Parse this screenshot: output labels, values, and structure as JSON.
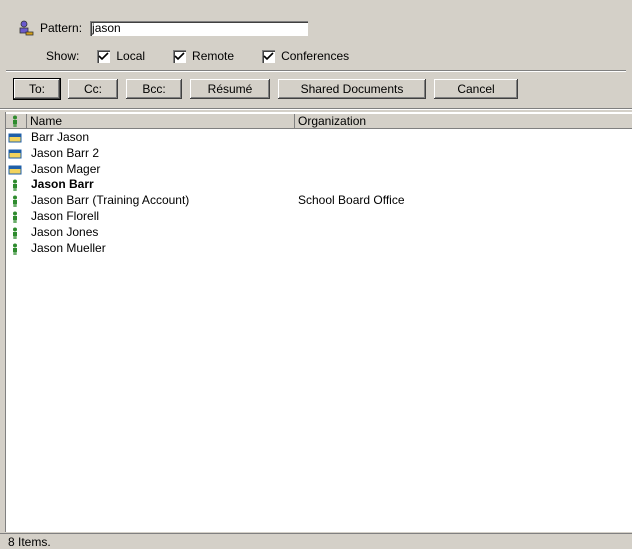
{
  "search": {
    "pattern_label": "Pattern:",
    "pattern_value": "jason",
    "show_label": "Show:",
    "filters": [
      {
        "label": "Local",
        "checked": true
      },
      {
        "label": "Remote",
        "checked": true
      },
      {
        "label": "Conferences",
        "checked": true
      }
    ]
  },
  "buttons": {
    "to": "To:",
    "cc": "Cc:",
    "bcc": "Bcc:",
    "resume": "Résumé",
    "shared_documents": "Shared Documents",
    "cancel": "Cancel"
  },
  "list": {
    "columns": {
      "name": "Name",
      "organization": "Organization"
    },
    "rows": [
      {
        "icon": "group-card-icon",
        "name": "Barr Jason",
        "organization": "",
        "bold": false
      },
      {
        "icon": "group-card-icon",
        "name": "Jason Barr 2",
        "organization": "",
        "bold": false
      },
      {
        "icon": "group-card-icon",
        "name": "Jason Mager",
        "organization": "",
        "bold": false
      },
      {
        "icon": "person-icon",
        "name": "Jason Barr",
        "organization": "",
        "bold": true
      },
      {
        "icon": "person-icon",
        "name": "Jason Barr (Training Account)",
        "organization": "School Board Office",
        "bold": false
      },
      {
        "icon": "person-icon",
        "name": "Jason Florell",
        "organization": "",
        "bold": false
      },
      {
        "icon": "person-icon",
        "name": "Jason Jones",
        "organization": "",
        "bold": false
      },
      {
        "icon": "person-icon",
        "name": "Jason Mueller",
        "organization": "",
        "bold": false
      }
    ]
  },
  "status": {
    "text": "8 Items."
  },
  "colors": {
    "person_icon": "#2e8b2e",
    "group_icon": "#1f5fa8",
    "group_icon_fill": "#f2d35c"
  }
}
